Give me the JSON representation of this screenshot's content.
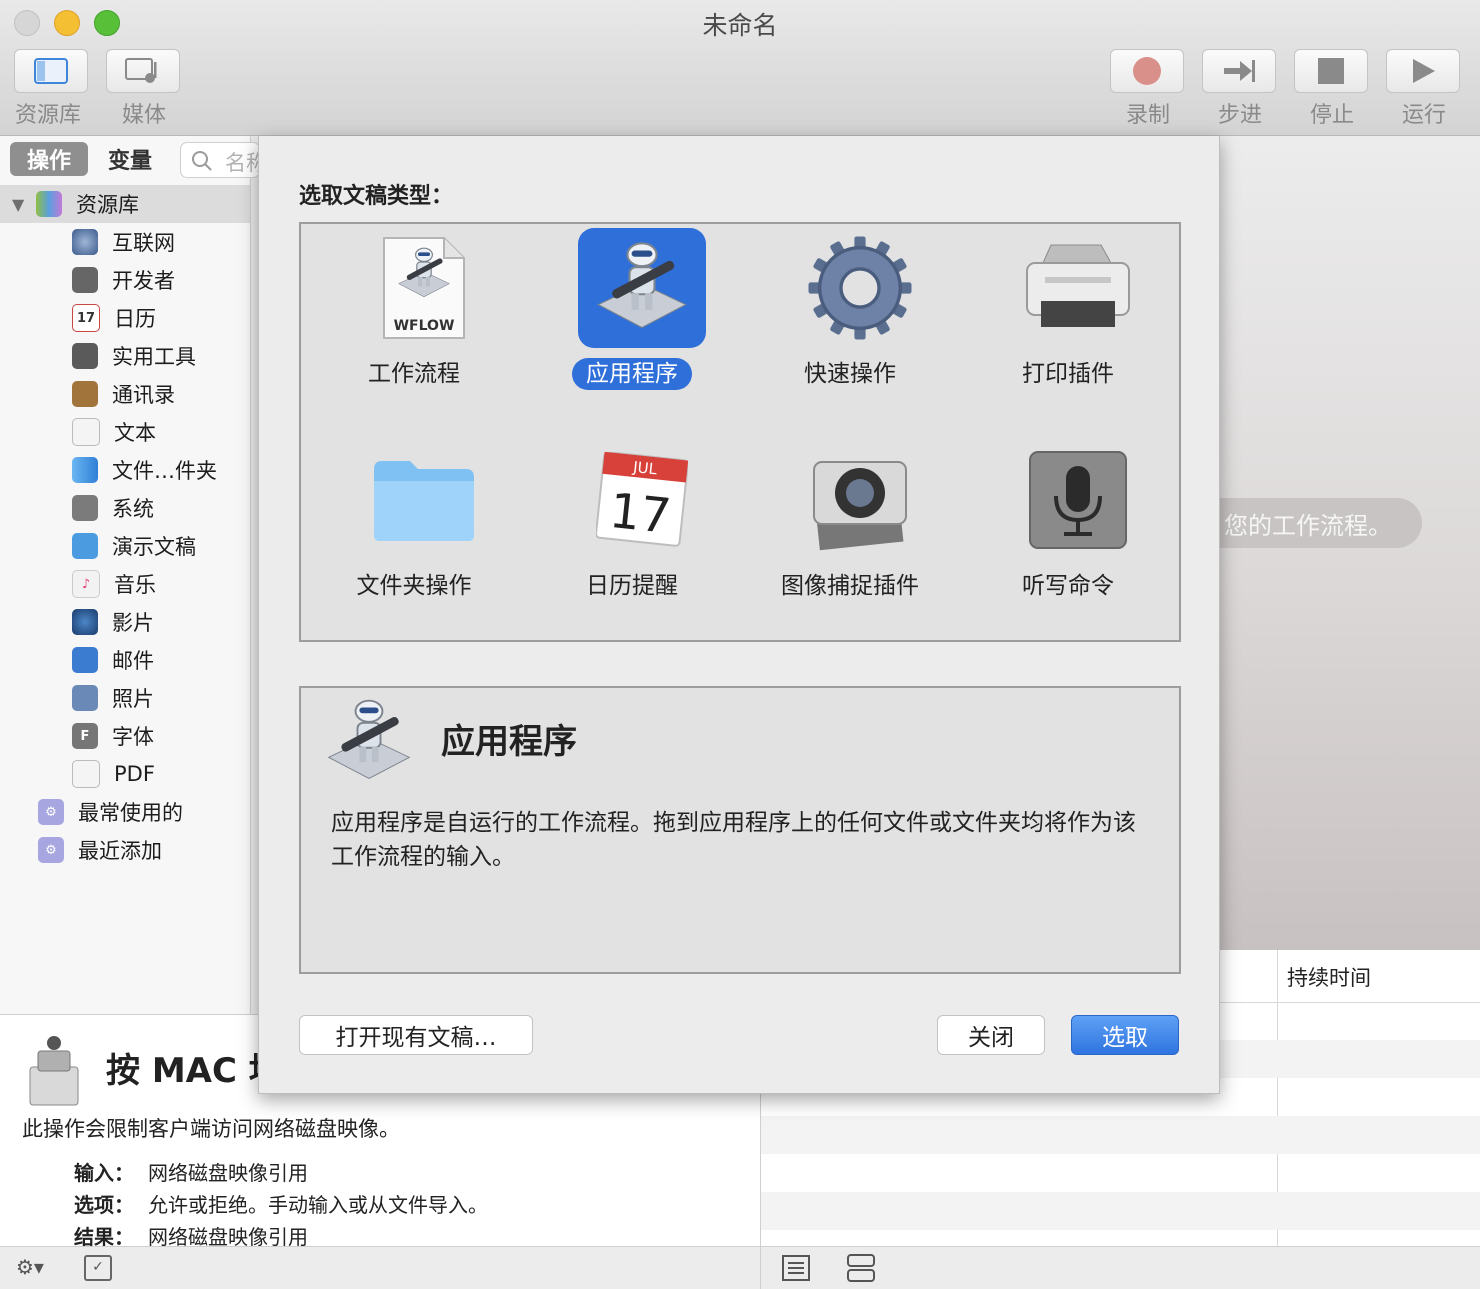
{
  "window": {
    "title": "未命名"
  },
  "toolbar": {
    "library_label": "资源库",
    "media_label": "媒体",
    "record_label": "录制",
    "step_label": "步进",
    "stop_label": "停止",
    "run_label": "运行"
  },
  "leftpane": {
    "tabs": {
      "actions": "操作",
      "variables": "变量"
    },
    "search_placeholder": "名称",
    "library_root": "资源库",
    "items": [
      "互联网",
      "开发者",
      "日历",
      "实用工具",
      "通讯录",
      "文本",
      "文件…件夹",
      "系统",
      "演示文稿",
      "音乐",
      "影片",
      "邮件",
      "照片",
      "字体",
      "PDF"
    ],
    "groups": [
      "最常使用的",
      "最近添加"
    ]
  },
  "action_desc": {
    "title": "按 MAC 地",
    "summary": "此操作会限制客户端访问网络磁盘映像。",
    "rows": [
      {
        "key": "输入：",
        "value": "网络磁盘映像引用"
      },
      {
        "key": "选项：",
        "value": "允许或拒绝。手动输入或从文件导入。"
      },
      {
        "key": "结果：",
        "value": "网络磁盘映像引用"
      }
    ]
  },
  "workarea": {
    "hint": "您的工作流程。"
  },
  "log": {
    "duration_header": "持续时间"
  },
  "sheet": {
    "prompt": "选取文稿类型：",
    "types": [
      {
        "label": "工作流程",
        "icon": "workflow-file-icon",
        "file_badge": "WFLOW"
      },
      {
        "label": "应用程序",
        "icon": "automator-robot-icon"
      },
      {
        "label": "快速操作",
        "icon": "gear-icon"
      },
      {
        "label": "打印插件",
        "icon": "printer-icon"
      },
      {
        "label": "文件夹操作",
        "icon": "folder-icon"
      },
      {
        "label": "日历提醒",
        "icon": "calendar-icon",
        "month": "JUL",
        "day": "17"
      },
      {
        "label": "图像捕捉插件",
        "icon": "camera-icon"
      },
      {
        "label": "听写命令",
        "icon": "microphone-icon"
      }
    ],
    "selected_index": 1,
    "detail_title": "应用程序",
    "detail_text": "应用程序是自运行的工作流程。拖到应用程序上的任何文件或文件夹均将作为该工作流程的输入。",
    "open_existing_button": "打开现有文稿…",
    "close_button": "关闭",
    "choose_button": "选取"
  },
  "colors": {
    "accent": "#2f74e0",
    "selection": "#2e6fd9"
  }
}
